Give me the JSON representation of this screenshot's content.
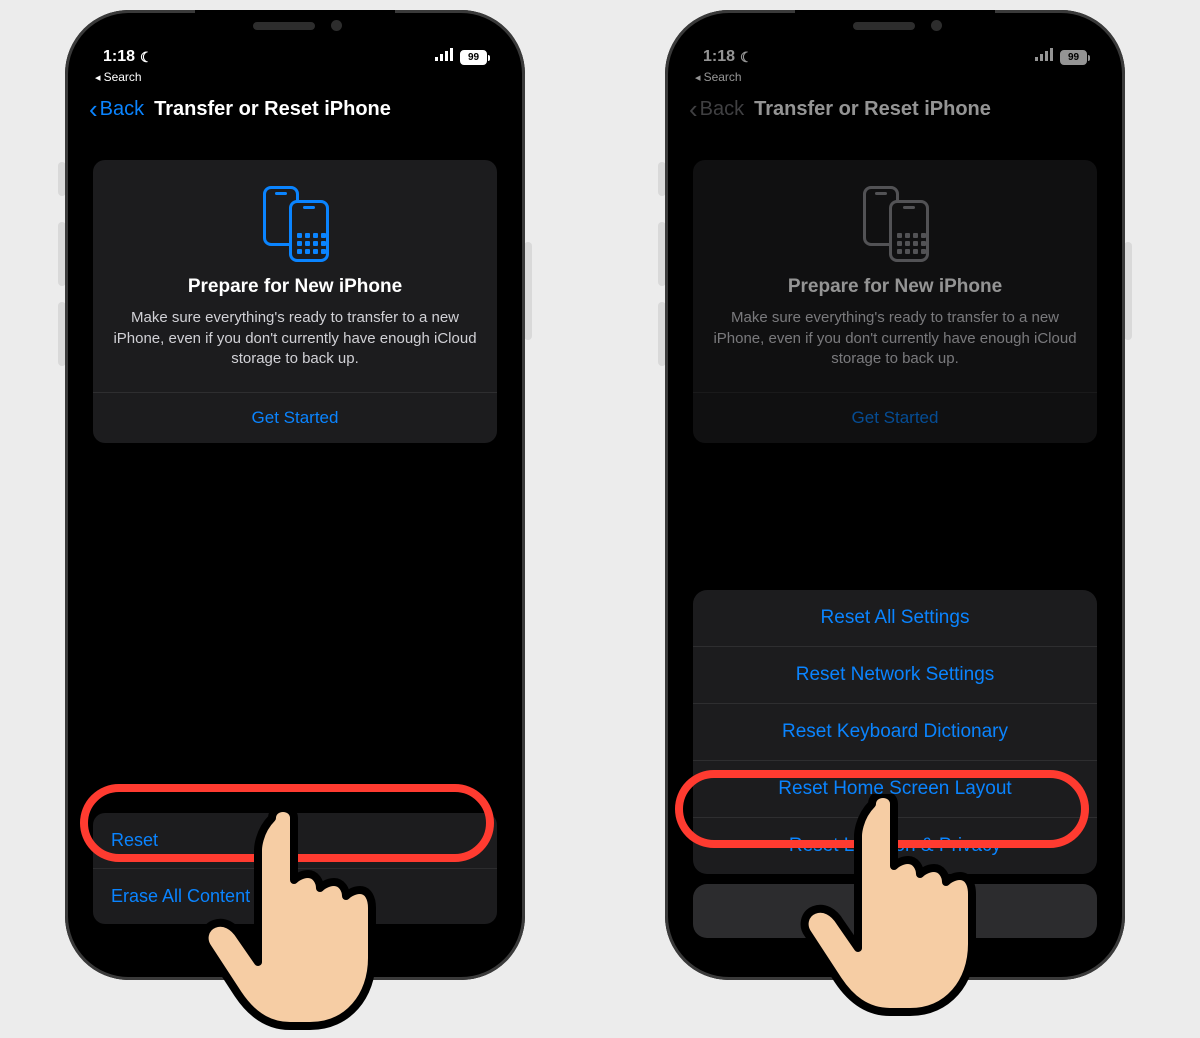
{
  "status": {
    "time": "1:18",
    "battery": "99",
    "breadcrumb": "Search"
  },
  "nav": {
    "back": "Back",
    "title": "Transfer or Reset iPhone"
  },
  "card": {
    "title": "Prepare for New iPhone",
    "desc": "Make sure everything's ready to transfer to a new iPhone, even if you don't currently have enough iCloud storage to back up.",
    "action": "Get Started"
  },
  "list": {
    "reset": "Reset",
    "erase": "Erase All Content and Settings"
  },
  "sheet": {
    "items": [
      "Reset All Settings",
      "Reset Network Settings",
      "Reset Keyboard Dictionary",
      "Reset Home Screen Layout",
      "Reset Location & Privacy"
    ]
  }
}
